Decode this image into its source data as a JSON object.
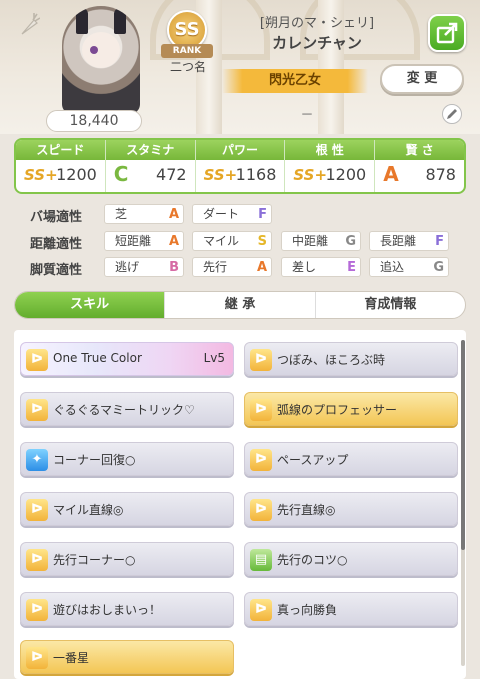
{
  "header": {
    "fans": "18,440",
    "rank": {
      "grade": "SS",
      "label": "RANK"
    },
    "nickname": "二つ名",
    "outfit": "[朔月のマ・シェリ]",
    "name": "カレンチャン",
    "epithet": "閃光乙女",
    "change_label": "変 更",
    "memo": "－"
  },
  "stats": [
    {
      "label": "スピード",
      "icon": "shoe-icon",
      "rank": "SS+",
      "value": "1200"
    },
    {
      "label": "スタミナ",
      "icon": "heart-icon",
      "rank": "C",
      "value": "472"
    },
    {
      "label": "パワー",
      "icon": "muscle-icon",
      "rank": "SS+",
      "value": "1168"
    },
    {
      "label": "根 性",
      "icon": "flame-icon",
      "rank": "SS+",
      "value": "1200"
    },
    {
      "label": "賢 さ",
      "icon": "mortarboard-icon",
      "rank": "A",
      "value": "878"
    }
  ],
  "aptitude": {
    "track_label": "バ場適性",
    "distance_label": "距離適性",
    "style_label": "脚質適性",
    "track": [
      {
        "name": "芝",
        "grade": "A"
      },
      {
        "name": "ダート",
        "grade": "F"
      }
    ],
    "distance": [
      {
        "name": "短距離",
        "grade": "A"
      },
      {
        "name": "マイル",
        "grade": "S"
      },
      {
        "name": "中距離",
        "grade": "G"
      },
      {
        "name": "長距離",
        "grade": "F"
      }
    ],
    "style": [
      {
        "name": "逃げ",
        "grade": "B"
      },
      {
        "name": "先行",
        "grade": "A"
      },
      {
        "name": "差し",
        "grade": "E"
      },
      {
        "name": "追込",
        "grade": "G"
      }
    ]
  },
  "tabs": [
    "スキル",
    "継 承",
    "育成情報"
  ],
  "skills": [
    {
      "name": "One True Color",
      "level": "Lv5",
      "style": "rainbow",
      "icon": "speed-icon"
    },
    {
      "name": "つぼみ、ほころぶ時",
      "style": "white",
      "icon": "speed-icon"
    },
    {
      "name": "ぐるぐるマミートリック♡",
      "style": "white",
      "icon": "speed-icon"
    },
    {
      "name": "弧線のプロフェッサー",
      "style": "gold",
      "icon": "speed-icon"
    },
    {
      "name": "コーナー回復○",
      "style": "white",
      "icon": "recovery-icon"
    },
    {
      "name": "ペースアップ",
      "style": "white",
      "icon": "speed-icon"
    },
    {
      "name": "マイル直線◎",
      "style": "white",
      "icon": "speed-icon"
    },
    {
      "name": "先行直線◎",
      "style": "white",
      "icon": "speed-icon"
    },
    {
      "name": "先行コーナー○",
      "style": "white",
      "icon": "speed-icon"
    },
    {
      "name": "先行のコツ○",
      "style": "white",
      "icon": "green-book-icon"
    },
    {
      "name": "遊びはおしまいっ！",
      "style": "white",
      "icon": "speed-icon"
    },
    {
      "name": "真っ向勝負",
      "style": "white",
      "icon": "speed-icon"
    },
    {
      "name": "一番星",
      "style": "gold",
      "icon": "speed-icon"
    }
  ],
  "scroll_position": 0.0
}
